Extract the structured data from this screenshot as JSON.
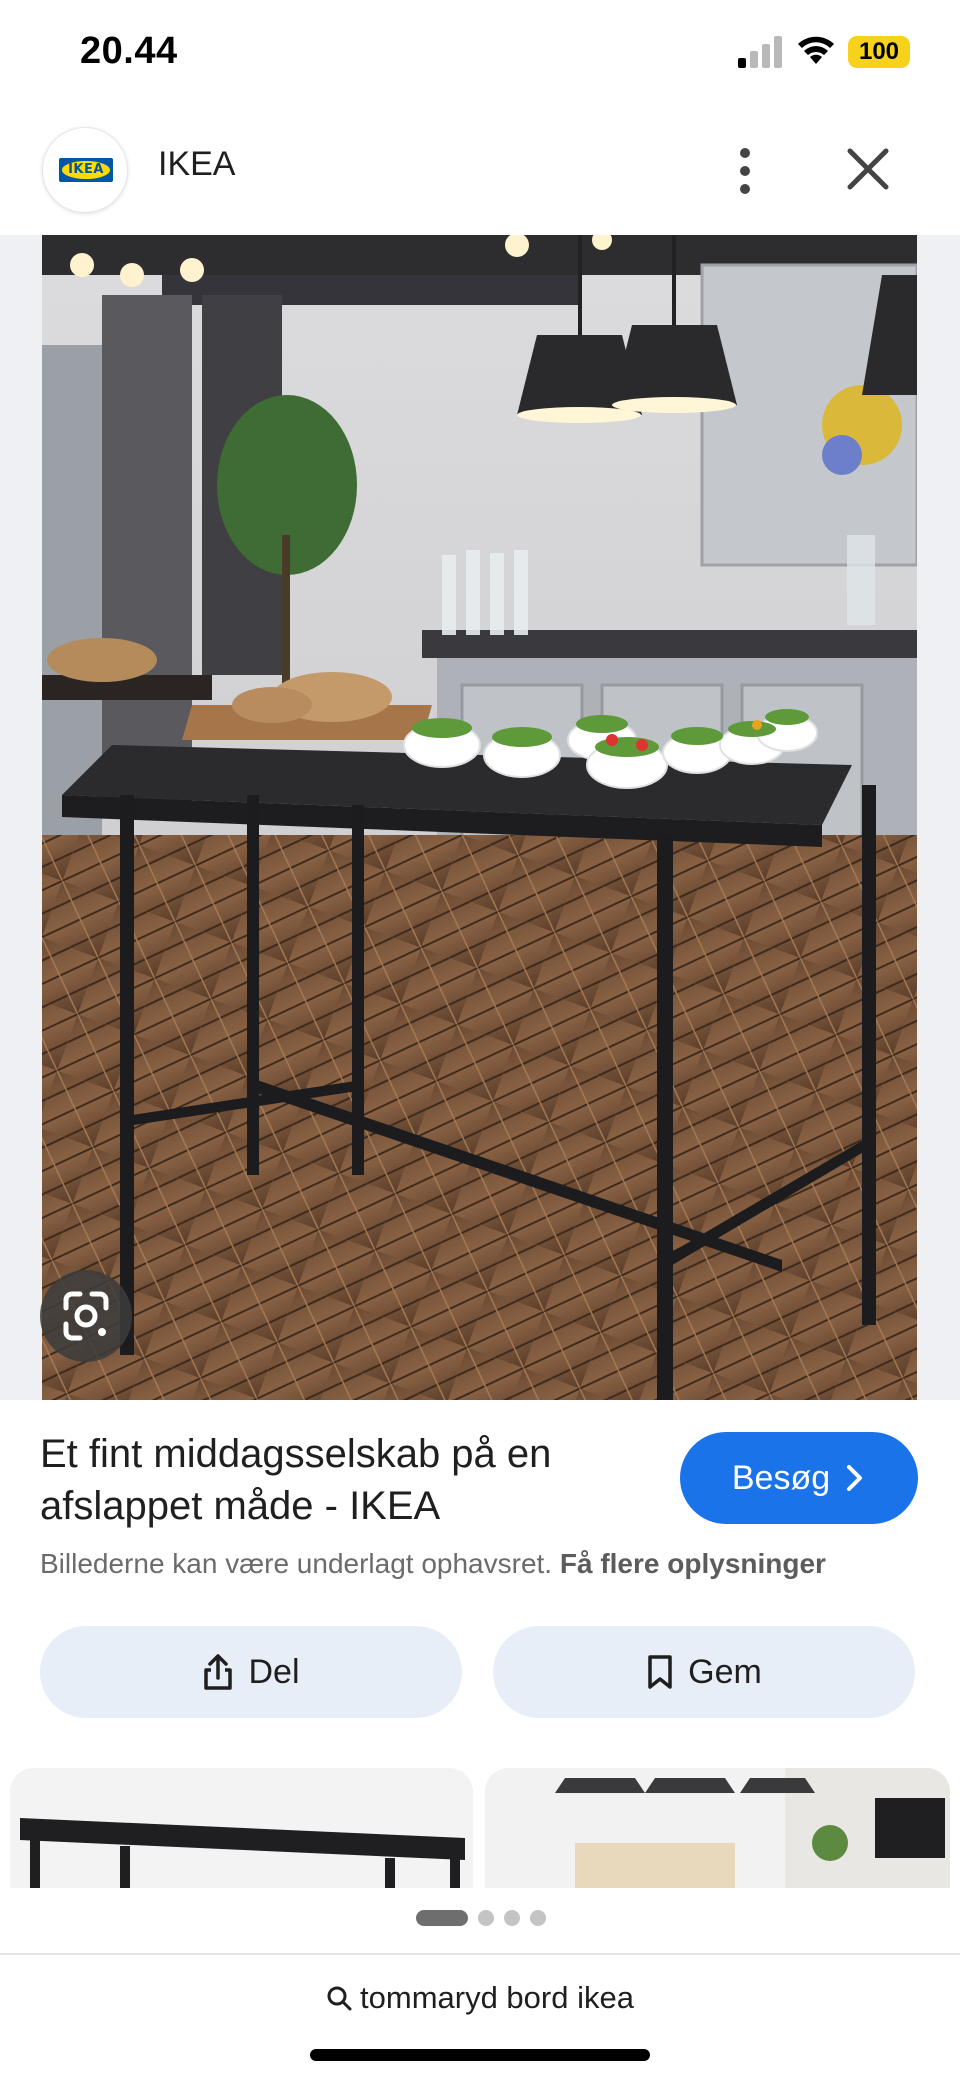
{
  "status_bar": {
    "time": "20.44",
    "battery": "100",
    "battery_color": "#f6d21b"
  },
  "header": {
    "site_name": "IKEA",
    "logo_text": "IKEA",
    "logo_colors": {
      "blue": "#0058a3",
      "yellow": "#ffdb00"
    },
    "more_icon": "more-vert-icon",
    "close_icon": "close-icon"
  },
  "image": {
    "lens_icon": "google-lens-icon"
  },
  "result": {
    "title": "Et fint middagsselskab på en afslappet måde - IKEA",
    "visit_label": "Besøg",
    "visit_icon": "chevron-right-icon",
    "copyright_text": "Billederne kan være underlagt ophavsret.",
    "copyright_link": "Få flere oplysninger",
    "accent_color": "#1a73e8"
  },
  "actions": {
    "share_label": "Del",
    "share_icon": "share-icon",
    "save_label": "Gem",
    "save_icon": "bookmark-icon"
  },
  "pager": {
    "count": 4,
    "active_index": 0
  },
  "search": {
    "query": "tommaryd bord ikea",
    "icon": "search-icon"
  }
}
